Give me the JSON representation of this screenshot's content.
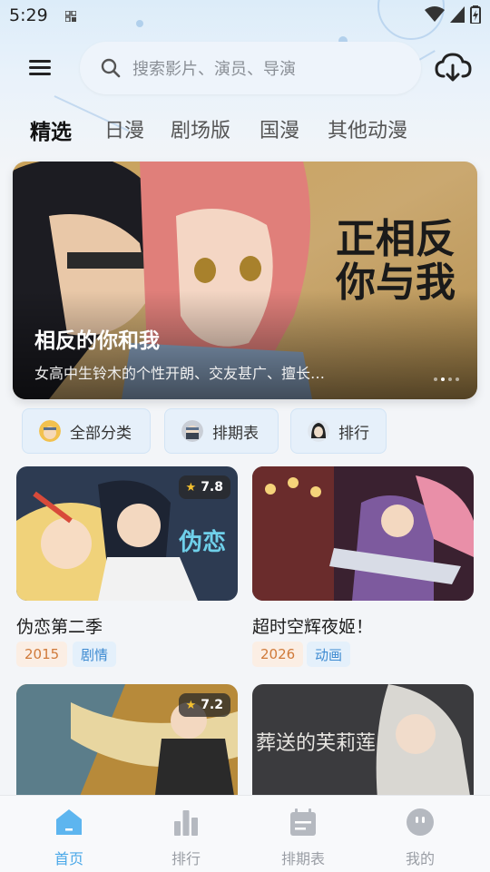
{
  "status_bar": {
    "time": "5:29"
  },
  "search": {
    "placeholder": "搜索影片、演员、导演"
  },
  "tabs": [
    {
      "label": "精选",
      "active": true
    },
    {
      "label": "日漫"
    },
    {
      "label": "剧场版"
    },
    {
      "label": "国漫"
    },
    {
      "label": "其他动漫"
    }
  ],
  "banner": {
    "logo_text": "正相反的你与我",
    "title": "相反的你和我",
    "description": "女高中生铃木的个性开朗、交友甚广、擅长…",
    "page_count": 4,
    "active_page": 2
  },
  "chips": [
    {
      "label": "全部分类",
      "icon": "naruto-avatar-icon"
    },
    {
      "label": "排期表",
      "icon": "kakashi-avatar-icon"
    },
    {
      "label": "排行",
      "icon": "itachi-avatar-icon"
    }
  ],
  "cards": [
    {
      "title": "伪恋第二季",
      "rating": "7.8",
      "year": "2015",
      "genre": "剧情",
      "poster_text": "伪恋"
    },
    {
      "title": "超时空辉夜姬！",
      "year": "2026",
      "genre": "动画"
    },
    {
      "rating": "7.2"
    },
    {
      "poster_text": "葬送的芙莉莲"
    }
  ],
  "bottom_nav": [
    {
      "label": "首页",
      "icon": "home-icon",
      "active": true
    },
    {
      "label": "排行",
      "icon": "bar-chart-icon"
    },
    {
      "label": "排期表",
      "icon": "calendar-icon"
    },
    {
      "label": "我的",
      "icon": "profile-icon"
    }
  ],
  "colors": {
    "accent": "#4aa8e8",
    "year_tag_text": "#d07a3a",
    "genre_tag_text": "#3d8ad1"
  }
}
